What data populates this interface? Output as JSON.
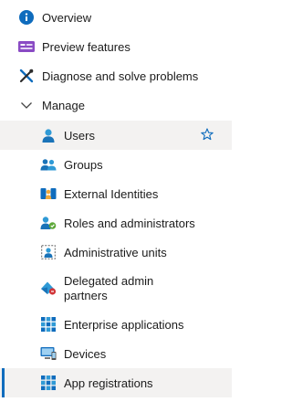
{
  "nav": {
    "overview": "Overview",
    "preview_features": "Preview features",
    "diagnose": "Diagnose and solve problems",
    "manage": "Manage",
    "users": "Users",
    "groups": "Groups",
    "external_identities": "External Identities",
    "roles": "Roles and administrators",
    "admin_units": "Administrative units",
    "delegated": "Delegated admin partners",
    "enterprise_apps": "Enterprise applications",
    "devices": "Devices",
    "app_registrations": "App registrations"
  },
  "icons": {
    "overview": "info-icon",
    "preview_features": "preview-features-icon",
    "diagnose": "wrench-screwdriver-icon",
    "manage": "chevron-down-icon",
    "users": "user-icon",
    "favorite": "star-icon",
    "groups": "group-icon",
    "external_identities": "external-identities-icon",
    "roles": "roles-icon",
    "admin_units": "administrative-units-icon",
    "delegated": "delegated-admin-icon",
    "enterprise_apps": "enterprise-apps-icon",
    "devices": "devices-icon",
    "app_registrations": "app-registrations-icon"
  },
  "colors": {
    "accent": "#0f6cbd",
    "selected_bg": "#f3f2f1"
  }
}
